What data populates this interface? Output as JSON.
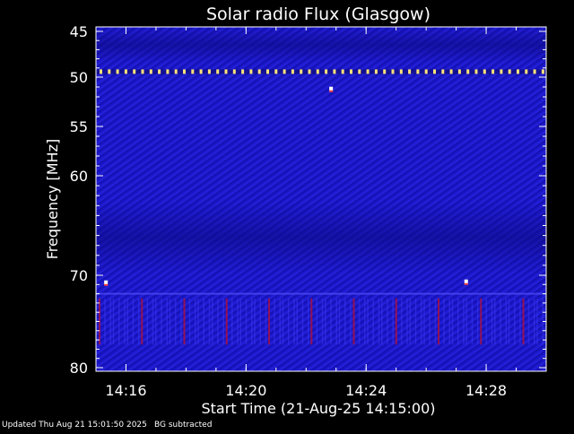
{
  "chart_data": {
    "type": "heatmap",
    "title": "Solar radio Flux (Glasgow)",
    "xlabel": "Start Time (21-Aug-25 14:15:00)",
    "ylabel": "Frequency [MHz]",
    "x_range": [
      "14:15:00",
      "14:30:00"
    ],
    "ylim": [
      45,
      80
    ],
    "x_ticks": [
      "14:16",
      "14:20",
      "14:24",
      "14:28"
    ],
    "y_ticks": [
      45,
      50,
      55,
      60,
      70,
      80
    ],
    "y_scale": "nonlinear (spacing compresses toward high frequency)",
    "colors": {
      "background": "#000000",
      "spectrum_base": "#1a16c8",
      "spectrum_dark": "#0c0a8a",
      "rfi_band": "#ffe27a",
      "spike": "#ffffff",
      "burst_red": "#b0103a"
    },
    "features": [
      {
        "name": "persistent interference band",
        "frequency_mhz": 49.4,
        "from": "14:15:00",
        "to": "14:30:00"
      },
      {
        "name": "spike",
        "time": "14:22:50",
        "frequency_mhz": 51.2
      },
      {
        "name": "spike",
        "time": "14:15:20",
        "frequency_mhz": 70.8
      },
      {
        "name": "spike",
        "time": "14:27:20",
        "frequency_mhz": 70.7
      },
      {
        "name": "horizontal line",
        "frequency_mhz": 72.0
      },
      {
        "name": "vertical interference streaks",
        "frequency_range_mhz": [
          72.5,
          77.5
        ]
      }
    ]
  },
  "footer": {
    "updated": "Updated Thu Aug 21 15:01:50 2025",
    "bg_note": "BG subtracted"
  }
}
